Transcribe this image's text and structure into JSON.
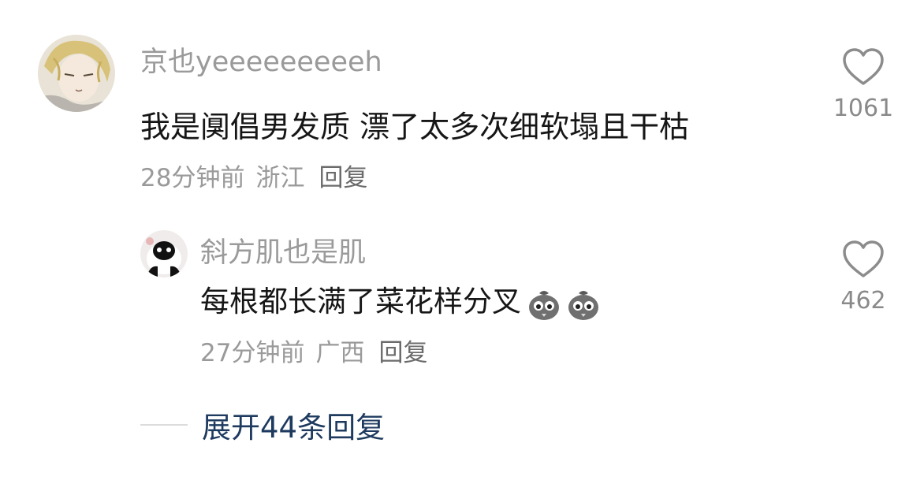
{
  "comments": [
    {
      "username": "京也yeeeeeeeeeh",
      "content": "我是阒倡男发质 漂了太多次细软塌且干枯",
      "time": "28分钟前",
      "location": "浙江",
      "reply_label": "回复",
      "likes": "1061",
      "avatar_icon": "anime-avatar-icon",
      "like_icon": "heart-outline-icon"
    }
  ],
  "replies": [
    {
      "username": "斜方肌也是肌",
      "content": "每根都长满了菜花样分叉",
      "emoji_icon": "crying-chick-emoji-icon",
      "time": "27分钟前",
      "location": "广西",
      "reply_label": "回复",
      "likes": "462",
      "avatar_icon": "panda-avatar-icon",
      "like_icon": "heart-outline-icon"
    }
  ],
  "expand": {
    "label": "展开44条回复"
  },
  "colors": {
    "username": "#9a9a9a",
    "content": "#161616",
    "meta": "#9a9a9a",
    "expand": "#1e3a5f",
    "heart_stroke": "#8c8c8c"
  }
}
